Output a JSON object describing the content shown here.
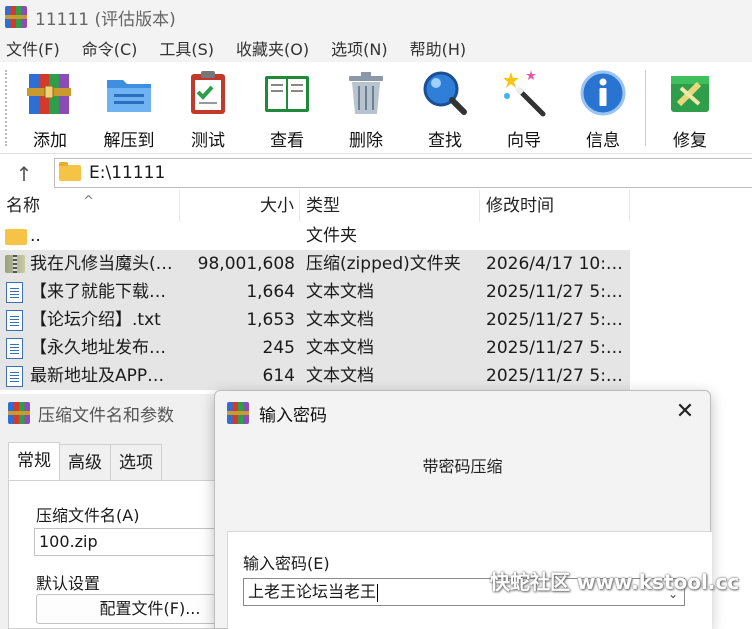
{
  "window": {
    "title": "11111 (评估版本)"
  },
  "menu": [
    "文件(F)",
    "命令(C)",
    "工具(S)",
    "收藏夹(O)",
    "选项(N)",
    "帮助(H)"
  ],
  "toolbar": {
    "add": "添加",
    "extract": "解压到",
    "test": "测试",
    "view": "查看",
    "delete": "删除",
    "find": "查找",
    "wizard": "向导",
    "info": "信息",
    "repair": "修复"
  },
  "address": {
    "path": "E:\\11111"
  },
  "filelist": {
    "columns": {
      "name": "名称",
      "size": "大小",
      "type": "类型",
      "modified": "修改时间"
    },
    "rows": [
      {
        "name": "..",
        "size": "",
        "type": "文件夹",
        "modified": ""
      },
      {
        "name": "我在凡修当魔头(…",
        "size": "98,001,608",
        "type": "压缩(zipped)文件夹",
        "modified": "2026/4/17 10:…"
      },
      {
        "name": "【来了就能下载…",
        "size": "1,664",
        "type": "文本文档",
        "modified": "2025/11/27 5:…"
      },
      {
        "name": "【论坛介绍】.txt",
        "size": "1,653",
        "type": "文本文档",
        "modified": "2025/11/27 5:…"
      },
      {
        "name": "【永久地址发布…",
        "size": "245",
        "type": "文本文档",
        "modified": "2025/11/27 5:…"
      },
      {
        "name": "最新地址及APP…",
        "size": "614",
        "type": "文本文档",
        "modified": "2025/11/27 5:…"
      }
    ]
  },
  "archive_dialog": {
    "title": "压缩文件名和参数",
    "tabs": [
      "常规",
      "高级",
      "选项"
    ],
    "archive_name_label": "压缩文件名(A)",
    "archive_name_value": "100.zip",
    "default_settings_label": "默认设置",
    "profiles_button": "配置文件(F)..."
  },
  "password_dialog": {
    "title": "输入密码",
    "subtitle": "带密码压缩",
    "password_label": "输入密码(E)",
    "password_value": "上老王论坛当老王"
  },
  "watermark": "快蛇社区 www.kstool.cc"
}
